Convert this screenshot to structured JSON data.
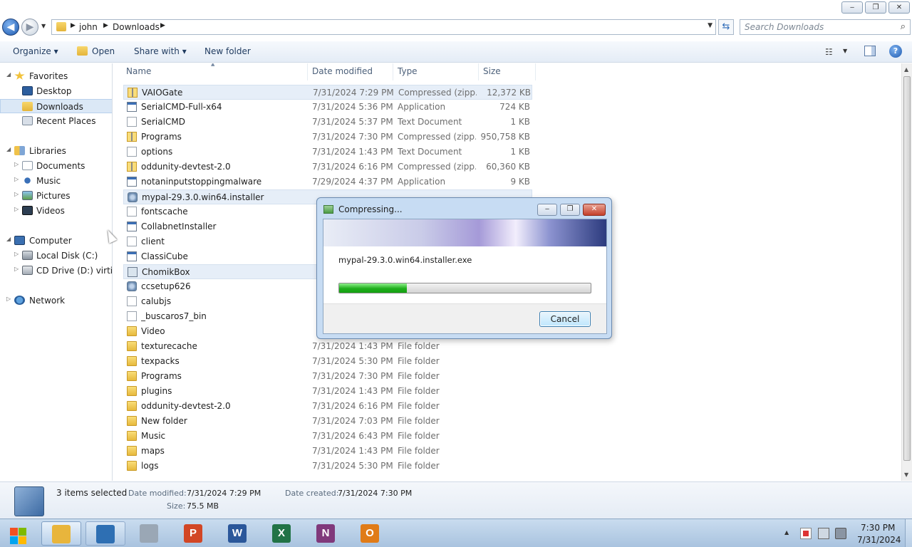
{
  "window": {
    "minimize_glyph": "‒",
    "maximize_glyph": "❐",
    "close_glyph": "✕"
  },
  "address": {
    "back_glyph": "◀",
    "forward_glyph": "▶",
    "crumbs": [
      "john",
      "Downloads"
    ],
    "arrow_glyph": "▶",
    "dropdown_glyph": "▼",
    "refresh_glyph": "⇆"
  },
  "search": {
    "placeholder": "Search Downloads",
    "icon_glyph": "⌕"
  },
  "toolbar": {
    "organize": "Organize ▾",
    "open": "Open",
    "share_with": "Share with ▾",
    "new_folder": "New folder",
    "views_glyph": "☷",
    "help_glyph": "?"
  },
  "nav": {
    "expand_glyph": "▷",
    "collapse_glyph": "◢",
    "favorites": "Favorites",
    "desktop": "Desktop",
    "downloads": "Downloads",
    "recent_places": "Recent Places",
    "libraries": "Libraries",
    "documents": "Documents",
    "music": "Music",
    "pictures": "Pictures",
    "videos": "Videos",
    "computer": "Computer",
    "local_disk": "Local Disk (C:)",
    "cd_drive": "CD Drive (D:) virtio-w",
    "network": "Network"
  },
  "columns": {
    "name": "Name",
    "date": "Date modified",
    "type": "Type",
    "size": "Size",
    "sort_glyph": "▲"
  },
  "files": [
    {
      "name": "VAIOGate",
      "date": "7/31/2024 7:29 PM",
      "type": "Compressed (zipp...",
      "size": "12,372 KB",
      "icon": "zip",
      "selected": true
    },
    {
      "name": "SerialCMD-Full-x64",
      "date": "7/31/2024 5:36 PM",
      "type": "Application",
      "size": "724 KB",
      "icon": "app",
      "selected": false
    },
    {
      "name": "SerialCMD",
      "date": "7/31/2024 5:37 PM",
      "type": "Text Document",
      "size": "1 KB",
      "icon": "doc",
      "selected": false
    },
    {
      "name": "Programs",
      "date": "7/31/2024 7:30 PM",
      "type": "Compressed (zipp...",
      "size": "950,758 KB",
      "icon": "zip",
      "selected": false
    },
    {
      "name": "options",
      "date": "7/31/2024 1:43 PM",
      "type": "Text Document",
      "size": "1 KB",
      "icon": "doc",
      "selected": false
    },
    {
      "name": "oddunity-devtest-2.0",
      "date": "7/31/2024 6:16 PM",
      "type": "Compressed (zipp...",
      "size": "60,360 KB",
      "icon": "zip",
      "selected": false
    },
    {
      "name": "notaninputstoppingmalware",
      "date": "7/29/2024 4:37 PM",
      "type": "Application",
      "size": "9 KB",
      "icon": "app",
      "selected": false
    },
    {
      "name": "mypal-29.3.0.win64.installer",
      "date": "",
      "type": "",
      "size": "",
      "icon": "inst",
      "selected": true
    },
    {
      "name": "fontscache",
      "date": "",
      "type": "",
      "size": "",
      "icon": "doc",
      "selected": false
    },
    {
      "name": "CollabnetInstaller",
      "date": "",
      "type": "",
      "size": "",
      "icon": "app",
      "selected": false
    },
    {
      "name": "client",
      "date": "",
      "type": "",
      "size": "",
      "icon": "doc",
      "selected": false
    },
    {
      "name": "ClassiCube",
      "date": "",
      "type": "",
      "size": "",
      "icon": "app",
      "selected": false
    },
    {
      "name": "ChomikBox",
      "date": "",
      "type": "",
      "size": "",
      "icon": "chomik",
      "selected": true
    },
    {
      "name": "ccsetup626",
      "date": "",
      "type": "",
      "size": "",
      "icon": "inst",
      "selected": false
    },
    {
      "name": "calubjs",
      "date": "",
      "type": "",
      "size": "",
      "icon": "doc",
      "selected": false
    },
    {
      "name": "_buscaros7_bin",
      "date": "",
      "type": "",
      "size": "",
      "icon": "doc",
      "selected": false
    },
    {
      "name": "Video",
      "date": "",
      "type": "",
      "size": "",
      "icon": "folder",
      "selected": false
    },
    {
      "name": "texturecache",
      "date": "7/31/2024 1:43 PM",
      "type": "File folder",
      "size": "",
      "icon": "folder",
      "selected": false
    },
    {
      "name": "texpacks",
      "date": "7/31/2024 5:30 PM",
      "type": "File folder",
      "size": "",
      "icon": "folder",
      "selected": false
    },
    {
      "name": "Programs",
      "date": "7/31/2024 7:30 PM",
      "type": "File folder",
      "size": "",
      "icon": "folder",
      "selected": false
    },
    {
      "name": "plugins",
      "date": "7/31/2024 1:43 PM",
      "type": "File folder",
      "size": "",
      "icon": "folder",
      "selected": false
    },
    {
      "name": "oddunity-devtest-2.0",
      "date": "7/31/2024 6:16 PM",
      "type": "File folder",
      "size": "",
      "icon": "folder",
      "selected": false
    },
    {
      "name": "New folder",
      "date": "7/31/2024 7:03 PM",
      "type": "File folder",
      "size": "",
      "icon": "folder",
      "selected": false
    },
    {
      "name": "Music",
      "date": "7/31/2024 6:43 PM",
      "type": "File folder",
      "size": "",
      "icon": "folder",
      "selected": false
    },
    {
      "name": "maps",
      "date": "7/31/2024 1:43 PM",
      "type": "File folder",
      "size": "",
      "icon": "folder",
      "selected": false
    },
    {
      "name": "logs",
      "date": "7/31/2024 5:30 PM",
      "type": "File folder",
      "size": "",
      "icon": "folder",
      "selected": false
    }
  ],
  "details": {
    "count": "3 items selected",
    "date_modified_label": "Date modified:",
    "date_modified": "7/31/2024 7:29 PM",
    "date_created_label": "Date created:",
    "date_created": "7/31/2024 7:30 PM",
    "size_label": "Size:",
    "size": "75.5 MB"
  },
  "dialog": {
    "title": "Compressing...",
    "filename": "mypal-29.3.0.win64.installer.exe",
    "progress": 0.27,
    "cancel": "Cancel"
  },
  "taskbar": {
    "apps": [
      {
        "name": "explorer",
        "glyph": "",
        "color": "#e8b53c",
        "state": "active"
      },
      {
        "name": "browser",
        "glyph": "",
        "color": "#2e6fb3",
        "state": "open"
      },
      {
        "name": "package",
        "glyph": "",
        "color": "#9aa7b5",
        "state": "none"
      },
      {
        "name": "powerpoint",
        "glyph": "P",
        "color": "#d24625",
        "state": "none"
      },
      {
        "name": "word",
        "glyph": "W",
        "color": "#2b579a",
        "state": "none"
      },
      {
        "name": "excel",
        "glyph": "X",
        "color": "#217346",
        "state": "none"
      },
      {
        "name": "onenote",
        "glyph": "N",
        "color": "#80397b",
        "state": "none"
      },
      {
        "name": "outlook",
        "glyph": "O",
        "color": "#e07b17",
        "state": "none"
      }
    ],
    "tray_up_glyph": "▲",
    "time": "7:30 PM",
    "date": "7/31/2024"
  },
  "colors": {
    "selection": "#e6eef8",
    "progress": "#1fae1c",
    "accent": "#1e5ab0"
  }
}
